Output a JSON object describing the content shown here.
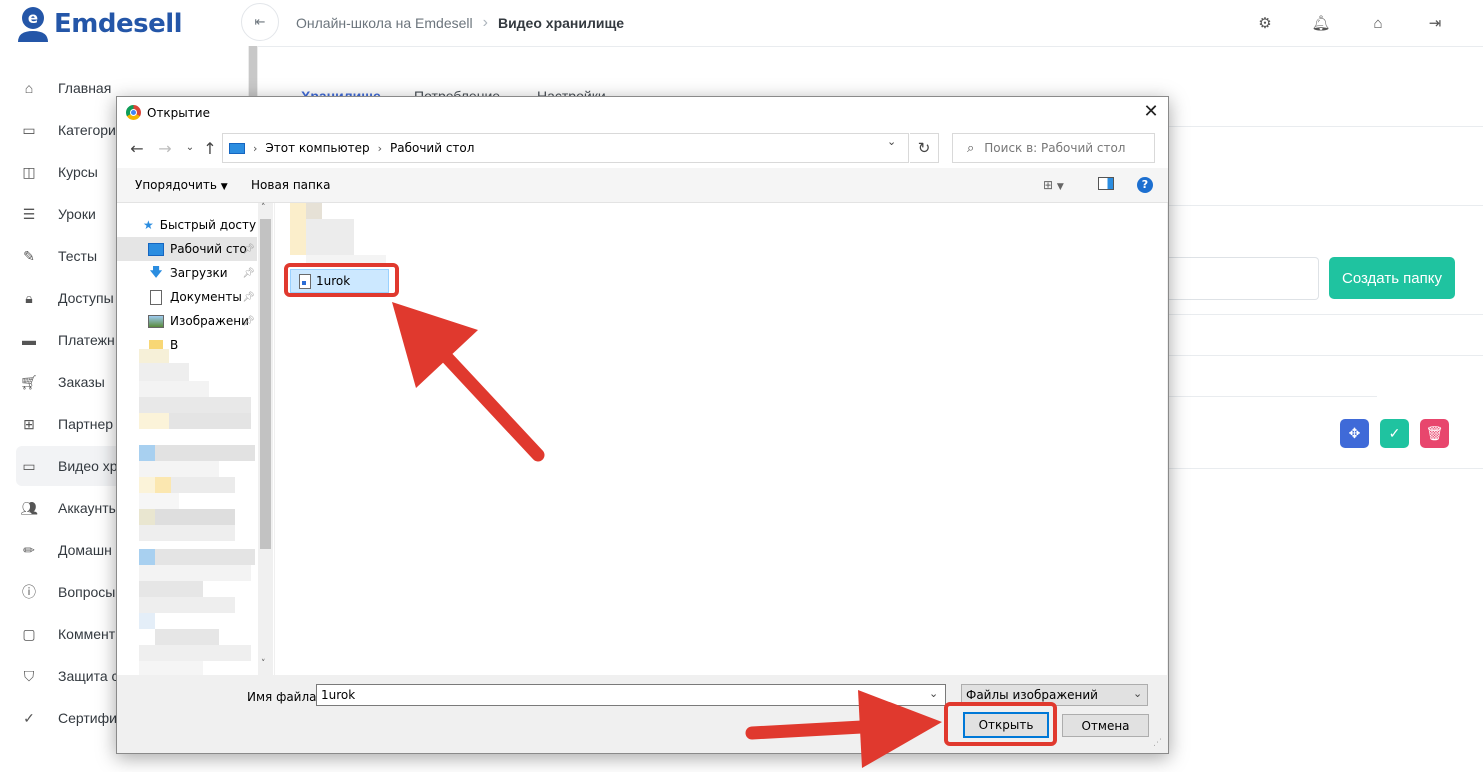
{
  "app": {
    "logo_text": "Emdesell",
    "breadcrumb": {
      "parent": "Онлайн-школа на Emdesell",
      "current": "Видео хранилище"
    },
    "top_icons": [
      "sliders-icon",
      "bell-icon",
      "home-gear-icon",
      "logout-icon"
    ],
    "sidebar": [
      {
        "label": "Главная",
        "icon": "home-icon"
      },
      {
        "label": "Категори",
        "icon": "folder-icon"
      },
      {
        "label": "Курсы",
        "icon": "book-icon"
      },
      {
        "label": "Уроки",
        "icon": "list-icon"
      },
      {
        "label": "Тесты",
        "icon": "edit-icon"
      },
      {
        "label": "Доступы",
        "icon": "lock-icon"
      },
      {
        "label": "Платежн",
        "icon": "card-icon"
      },
      {
        "label": "Заказы",
        "icon": "cart-icon"
      },
      {
        "label": "Партнер",
        "icon": "gift-icon"
      },
      {
        "label": "Видео хр",
        "icon": "video-icon"
      },
      {
        "label": "Аккаунты",
        "icon": "users-icon"
      },
      {
        "label": "Домашн",
        "icon": "pencil-icon"
      },
      {
        "label": "Вопросы",
        "icon": "question-icon"
      },
      {
        "label": "Коммент",
        "icon": "comment-icon"
      },
      {
        "label": "Защита с",
        "icon": "shield-icon"
      },
      {
        "label": "Сертифи",
        "icon": "certificate-icon"
      }
    ],
    "tabs": [
      "Хранилище",
      "Потребление",
      "Настройки"
    ],
    "create_folder_label": "Создать папку",
    "row_actions": [
      {
        "name": "move",
        "icon": "move-icon",
        "color": "#3f6ad8"
      },
      {
        "name": "confirm",
        "icon": "check-icon",
        "color": "#1fc3a0"
      },
      {
        "name": "delete",
        "icon": "trash-icon",
        "color": "#e8466d"
      }
    ]
  },
  "dialog": {
    "title": "Открытие",
    "address_path": [
      "Этот компьютер",
      "Рабочий стол"
    ],
    "search_placeholder": "Поиск в: Рабочий стол",
    "toolbar": {
      "organize": "Упорядочить",
      "new_folder": "Новая папка"
    },
    "nav_items": [
      {
        "label": "Быстрый доступ",
        "icon": "star-icon"
      },
      {
        "label": "Рабочий сто",
        "icon": "desktop-icon",
        "selected": true,
        "pinned": true
      },
      {
        "label": "Загрузки",
        "icon": "download-icon",
        "pinned": true
      },
      {
        "label": "Документы",
        "icon": "document-icon",
        "pinned": true
      },
      {
        "label": "Изображени",
        "icon": "picture-icon",
        "pinned": true
      },
      {
        "label": "В",
        "icon": "folder-icon"
      }
    ],
    "file_selected": "1urok",
    "filename_label": "Имя файла:",
    "filename_value": "1urok",
    "filetype_value": "Файлы изображений",
    "buttons": {
      "open": "Открыть",
      "cancel": "Отмена"
    }
  },
  "colors": {
    "accent": "#3f6ad8",
    "success": "#1fc3a0",
    "danger": "#e8466d",
    "highlight": "#e0392e"
  }
}
